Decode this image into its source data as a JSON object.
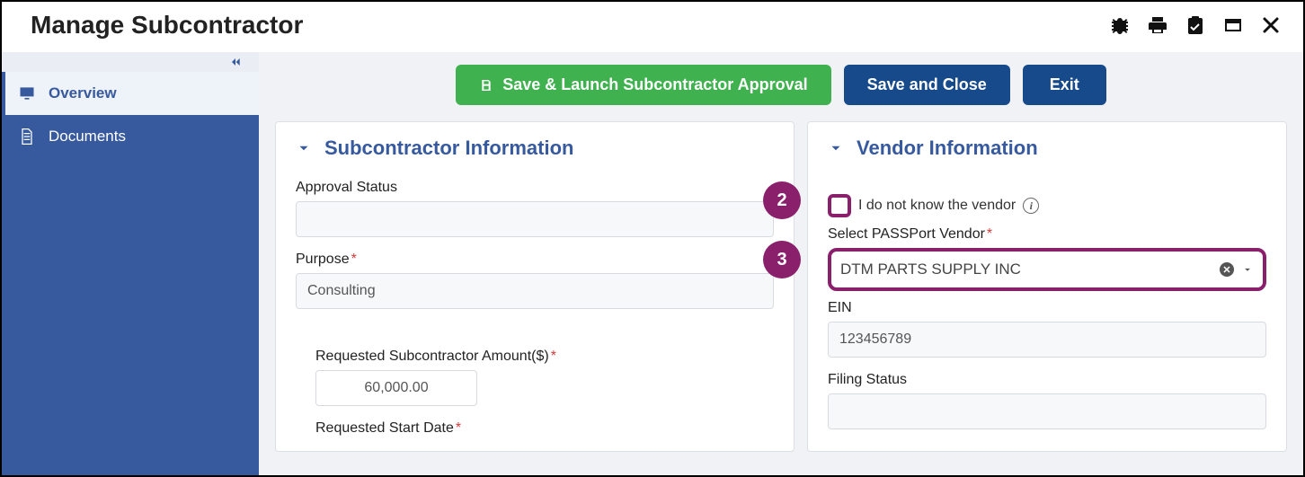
{
  "header": {
    "title": "Manage Subcontractor"
  },
  "sidebar": {
    "items": [
      {
        "label": "Overview"
      },
      {
        "label": "Documents"
      }
    ]
  },
  "actions": {
    "save_launch": "Save & Launch Subcontractor Approval",
    "save_close": "Save and Close",
    "exit": "Exit"
  },
  "subcontractor_panel": {
    "title": "Subcontractor Information",
    "approval_status_label": "Approval Status",
    "approval_status_value": "",
    "purpose_label": "Purpose",
    "purpose_value": "Consulting",
    "requested_amount_label": "Requested Subcontractor Amount($)",
    "requested_amount_value": "60,000.00",
    "requested_start_label": "Requested Start Date"
  },
  "vendor_panel": {
    "title": "Vendor Information",
    "unknown_vendor_label": "I do not know the vendor",
    "select_vendor_label": "Select PASSPort Vendor",
    "select_vendor_value": "DTM PARTS SUPPLY INC",
    "ein_label": "EIN",
    "ein_value": "123456789",
    "filing_status_label": "Filing Status",
    "filing_status_value": ""
  },
  "annotations": {
    "badge2": "2",
    "badge3": "3"
  }
}
